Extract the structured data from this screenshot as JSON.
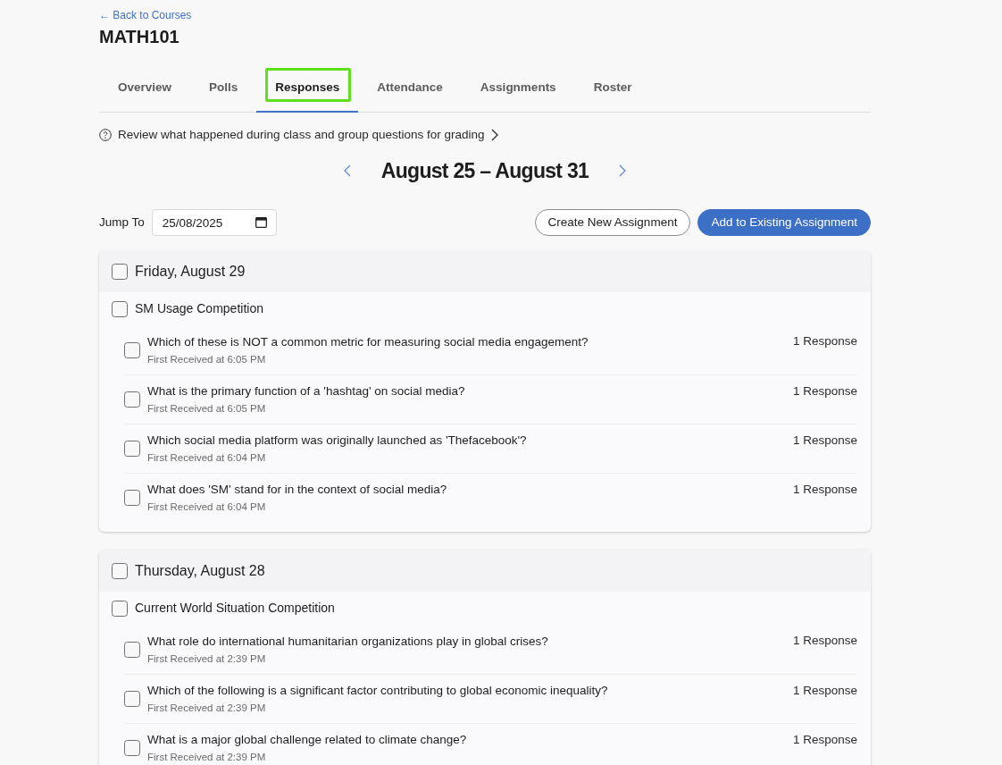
{
  "back_link": {
    "label": "← Back to Courses"
  },
  "course_title": "MATH101",
  "tabs": [
    {
      "label": "Overview",
      "selected": false,
      "outlined": false
    },
    {
      "label": "Polls",
      "selected": false,
      "outlined": false
    },
    {
      "label": "Responses",
      "selected": true,
      "outlined": true
    },
    {
      "label": "Attendance",
      "selected": false,
      "outlined": false
    },
    {
      "label": "Assignments",
      "selected": false,
      "outlined": false
    },
    {
      "label": "Roster",
      "selected": false,
      "outlined": false
    }
  ],
  "hint": {
    "text": "Review what happened during class and group questions for grading"
  },
  "week": {
    "title": "August 25 – August 31"
  },
  "jump_to": {
    "label": "Jump To",
    "value": "25/08/2025"
  },
  "actions": [
    {
      "label": "Create New Assignment",
      "kind": "outline"
    },
    {
      "label": "Add to Existing Assignment",
      "kind": "primary"
    }
  ],
  "days": [
    {
      "date": "Friday, August 29",
      "checked": false,
      "groups": [
        {
          "name": "SM Usage Competition",
          "checked": false,
          "questions": [
            {
              "text": "Which of these is NOT a common metric for measuring social media engagement?",
              "received": "First Received at 6:05 PM",
              "responses": "1 Response",
              "checked": false
            },
            {
              "text": "What is the primary function of a 'hashtag' on social media?",
              "received": "First Received at 6:05 PM",
              "responses": "1 Response",
              "checked": false
            },
            {
              "text": "Which social media platform was originally launched as 'Thefacebook'?",
              "received": "First Received at 6:04 PM",
              "responses": "1 Response",
              "checked": false
            },
            {
              "text": "What does 'SM' stand for in the context of social media?",
              "received": "First Received at 6:04 PM",
              "responses": "1 Response",
              "checked": false
            }
          ]
        }
      ]
    },
    {
      "date": "Thursday, August 28",
      "checked": false,
      "groups": [
        {
          "name": "Current World Situation Competition",
          "checked": false,
          "questions": [
            {
              "text": "What role do international humanitarian organizations play in global crises?",
              "received": "First Received at 2:39 PM",
              "responses": "1 Response",
              "checked": false
            },
            {
              "text": "Which of the following is a significant factor contributing to global economic inequality?",
              "received": "First Received at 2:39 PM",
              "responses": "1 Response",
              "checked": false
            },
            {
              "text": "What is a major global challenge related to climate change?",
              "received": "First Received at 2:39 PM",
              "responses": "1 Response",
              "checked": false
            }
          ]
        }
      ]
    }
  ]
}
